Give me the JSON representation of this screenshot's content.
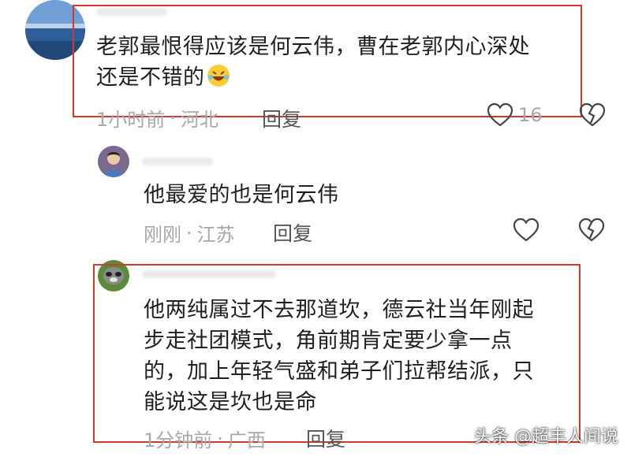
{
  "comments": [
    {
      "text_lines": [
        "老郭最恨得应该是何云伟，曹在老郭内心深处",
        "还是不错的"
      ],
      "emoji": "rolling-laughing-emoji",
      "time": "1小时前",
      "location": "河北",
      "reply_label": "回复",
      "likes": "16"
    },
    {
      "text_lines": [
        "他最爱的也是何云伟"
      ],
      "time": "刚刚",
      "location": "江苏",
      "reply_label": "回复"
    },
    {
      "text_lines": [
        "他两纯属过不去那道坎，德云社当年刚起",
        "步走社团模式，角前期肯定要少拿一点",
        "的，加上年轻气盛和弟子们拉帮结派，只",
        "能说这是坎也是命"
      ],
      "time": "1分钟前",
      "location": "广西",
      "reply_label": "回复"
    }
  ],
  "meta_separator": "·",
  "watermark": "头条 @超丰人间说",
  "colors": {
    "highlight": "#d03a2a",
    "meta": "#a8a8a8",
    "text": "#1f1f1f"
  }
}
